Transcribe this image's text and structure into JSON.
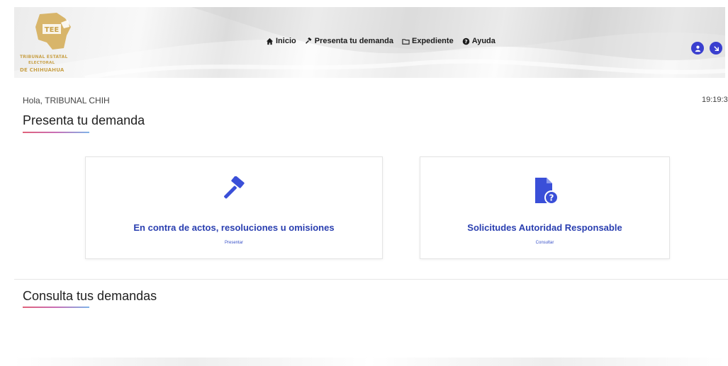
{
  "logo": {
    "mark_text": "TEE",
    "line1": "TRIBUNAL ESTATAL",
    "line2": "ELECTORAL",
    "line3": "DE CHIHUAHUA"
  },
  "nav": [
    {
      "label": "Inicio",
      "icon": "home-icon"
    },
    {
      "label": "Presenta tu demanda",
      "icon": "gavel-icon"
    },
    {
      "label": "Expediente",
      "icon": "folder-icon"
    },
    {
      "label": "Ayuda",
      "icon": "help-icon"
    }
  ],
  "header_buttons": [
    {
      "icon": "user-icon"
    },
    {
      "icon": "logout-icon"
    }
  ],
  "greeting": "Hola, TRIBUNAL CHIH",
  "clock": "19:19:3",
  "sections": {
    "present": "Presenta tu demanda",
    "consult": "Consulta tus demandas"
  },
  "cards": [
    {
      "title": "En contra de actos, resoluciones u omisiones",
      "action": "Presentar",
      "icon": "gavel-icon"
    },
    {
      "title": "Solicitudes Autoridad Responsable",
      "action": "Consultar",
      "icon": "file-question-icon"
    }
  ],
  "colors": {
    "accent": "#2a3fb0",
    "icon_blue": "#3a4fd8",
    "gold": "#c9a24a"
  }
}
